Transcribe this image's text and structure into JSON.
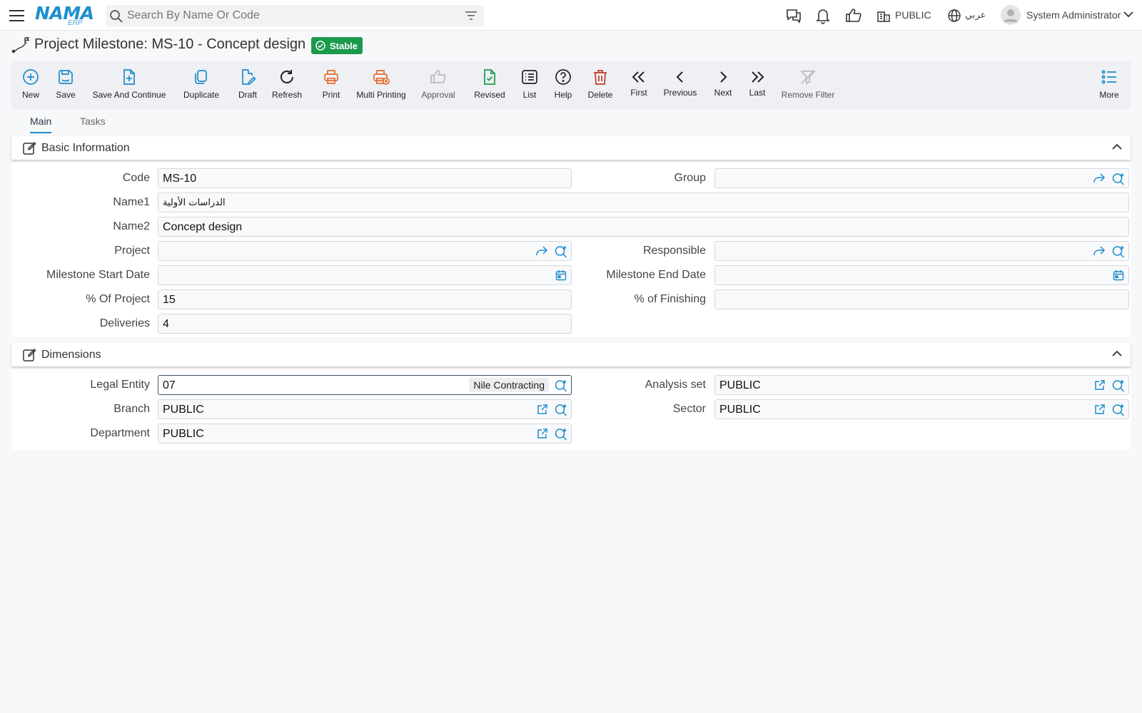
{
  "header": {
    "logo_main": "NAMA",
    "logo_sub": "ERP",
    "search_placeholder": "Search By Name Or Code",
    "company": "PUBLIC",
    "language": "عربي",
    "user_name": "System Administrator"
  },
  "page": {
    "title": "Project Milestone: MS-10 - Concept design",
    "status": "Stable"
  },
  "toolbar": {
    "new": "New",
    "save": "Save",
    "save_continue": "Save And Continue",
    "duplicate": "Duplicate",
    "draft": "Draft",
    "refresh": "Refresh",
    "print": "Print",
    "multi_printing": "Multi Printing",
    "approval": "Approval",
    "revised": "Revised",
    "list": "List",
    "help": "Help",
    "delete": "Delete",
    "first": "First",
    "previous": "Previous",
    "next": "Next",
    "last": "Last",
    "remove_filter": "Remove Filter",
    "more": "More"
  },
  "tabs": {
    "main": "Main",
    "tasks": "Tasks"
  },
  "basic": {
    "title": "Basic Information",
    "code_label": "Code",
    "code": "MS-10",
    "group_label": "Group",
    "group": "",
    "name1_label": "Name1",
    "name1": "الدراسات الأولية",
    "name2_label": "Name2",
    "name2": "Concept design",
    "project_label": "Project",
    "project": "",
    "responsible_label": "Responsible",
    "responsible": "",
    "start_label": "Milestone Start Date",
    "start": "",
    "end_label": "Milestone End Date",
    "end": "",
    "pct_project_label": "% Of Project",
    "pct_project": "15",
    "pct_finishing_label": "% of Finishing",
    "pct_finishing": "",
    "deliveries_label": "Deliveries",
    "deliveries": "4"
  },
  "dimensions": {
    "title": "Dimensions",
    "legal_entity_label": "Legal Entity",
    "legal_entity": "07",
    "legal_entity_name": "Nile Contracting",
    "analysis_set_label": "Analysis set",
    "analysis_set": "PUBLIC",
    "branch_label": "Branch",
    "branch": "PUBLIC",
    "sector_label": "Sector",
    "sector": "PUBLIC",
    "department_label": "Department",
    "department": "PUBLIC"
  },
  "colors": {
    "accent": "#1d8ccd",
    "status_green": "#1c9a4c",
    "print_orange": "#e8692a",
    "delete_red": "#c0392b"
  },
  "icons": {
    "menu": "hamburger-icon",
    "search": "search-icon",
    "filter": "filter-icon",
    "chat": "chat-icon",
    "notifications": "bell-icon",
    "like": "thumbs-up-icon",
    "company": "building-icon",
    "language": "globe-icon",
    "avatar": "user-avatar-icon"
  }
}
